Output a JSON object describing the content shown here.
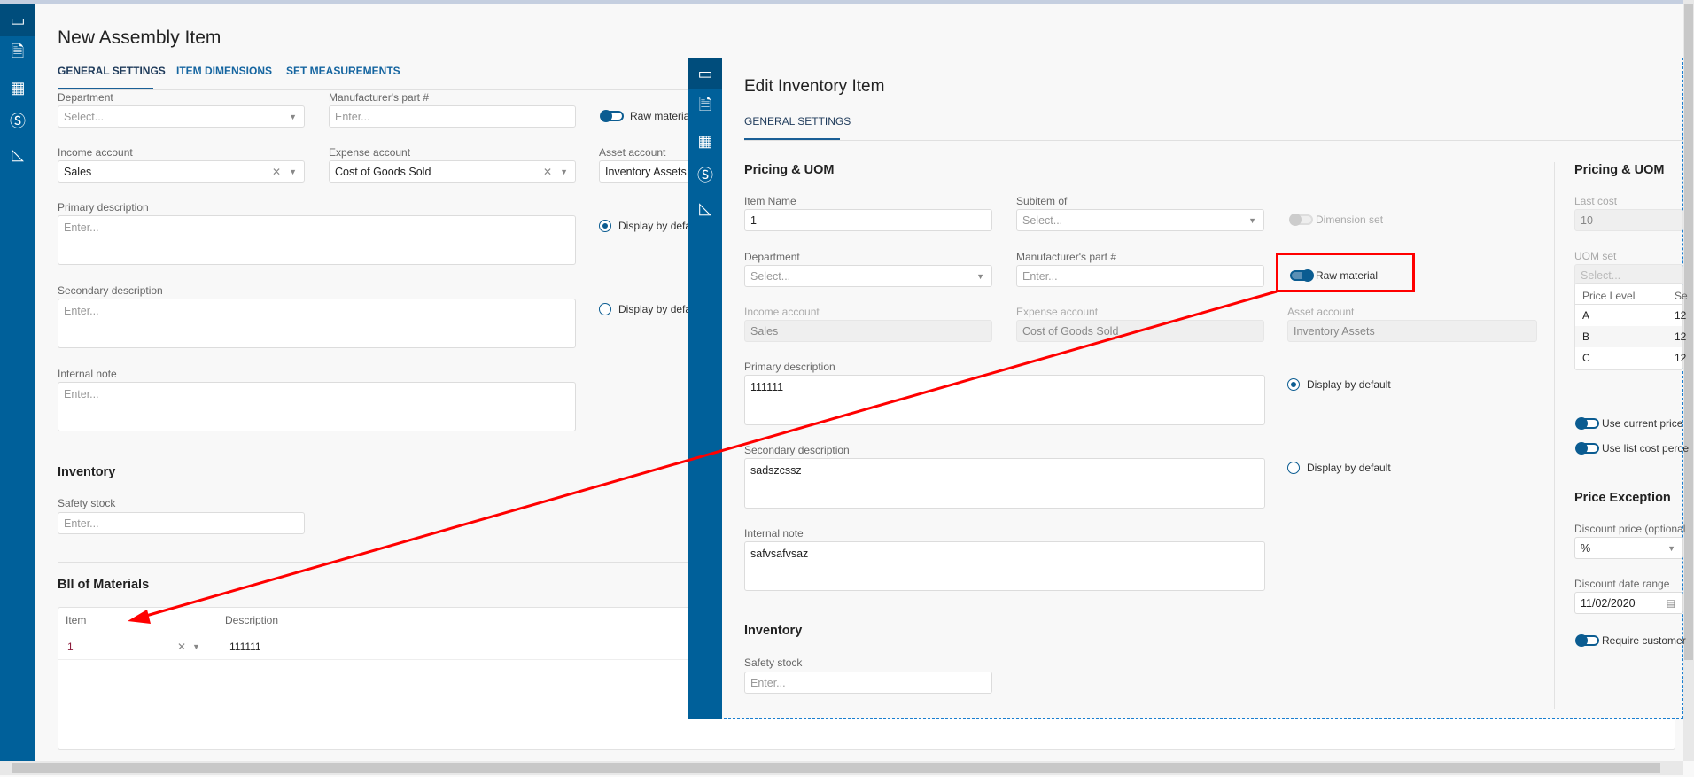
{
  "main": {
    "title": "New Assembly Item",
    "tabs": [
      "GENERAL SETTINGS",
      "ITEM DIMENSIONS",
      "SET MEASUREMENTS"
    ],
    "department": {
      "label": "Department",
      "placeholder": "Select..."
    },
    "manufacturer_part": {
      "label": "Manufacturer's part #",
      "placeholder": "Enter..."
    },
    "raw_material": "Raw material",
    "income_account": {
      "label": "Income account",
      "value": "Sales"
    },
    "expense_account": {
      "label": "Expense account",
      "value": "Cost of Goods Sold"
    },
    "asset_account": {
      "label": "Asset account",
      "value": "Inventory Assets"
    },
    "primary_description": {
      "label": "Primary description",
      "placeholder": "Enter..."
    },
    "secondary_description": {
      "label": "Secondary description",
      "placeholder": "Enter..."
    },
    "display_default_1": "Display by defa",
    "display_default_2": "Display by defa",
    "internal_note": {
      "label": "Internal note",
      "placeholder": "Enter..."
    },
    "inventory_heading": "Inventory",
    "safety_stock": {
      "label": "Safety stock",
      "placeholder": "Enter..."
    },
    "bom": {
      "heading": "Bll of Materials",
      "columns": [
        "Item",
        "Description"
      ],
      "rows": [
        {
          "item": "1",
          "description": "111111"
        }
      ]
    }
  },
  "dialog": {
    "title": "Edit Inventory Item",
    "tab": "GENERAL SETTINGS",
    "section": "Pricing & UOM",
    "item_name": {
      "label": "Item Name",
      "value": "1"
    },
    "subitem_of": {
      "label": "Subitem of",
      "placeholder": "Select..."
    },
    "dimension_set": "Dimension set",
    "department": {
      "label": "Department",
      "placeholder": "Select..."
    },
    "manufacturer_part": {
      "label": "Manufacturer's part #",
      "placeholder": "Enter..."
    },
    "raw_material": "Raw material",
    "income_account": {
      "label": "Income account",
      "value": "Sales"
    },
    "expense_account": {
      "label": "Expense account",
      "value": "Cost of Goods Sold"
    },
    "asset_account": {
      "label": "Asset account",
      "value": "Inventory Assets"
    },
    "primary_description": {
      "label": "Primary description",
      "value": "111111"
    },
    "secondary_description": {
      "label": "Secondary description",
      "value": "sadszcssz"
    },
    "display_default": "Display by default",
    "internal_note": {
      "label": "Internal note",
      "value": "safvsafvsaz"
    },
    "inventory_heading": "Inventory",
    "safety_stock": {
      "label": "Safety stock",
      "placeholder": "Enter..."
    },
    "right": {
      "section": "Pricing & UOM",
      "last_cost": {
        "label": "Last cost",
        "value": "10"
      },
      "uom_set": {
        "label": "UOM set",
        "placeholder": "Select..."
      },
      "price_table": {
        "columns": [
          "Price Level",
          "Se"
        ],
        "rows": [
          {
            "level": "A",
            "value": "12"
          },
          {
            "level": "B",
            "value": "12"
          },
          {
            "level": "C",
            "value": "12"
          }
        ]
      },
      "use_current_price": "Use current price",
      "use_list_cost": "Use list cost perce",
      "price_exception": "Price Exception",
      "discount_price": {
        "label": "Discount price (optional",
        "value": "%"
      },
      "discount_date_range": {
        "label": "Discount date range",
        "value": "11/02/2020"
      },
      "require_customer": "Require customer"
    }
  },
  "colors": {
    "sidebar": "#00609a",
    "accent": "#1a5f96",
    "annotation": "#ff0000"
  }
}
